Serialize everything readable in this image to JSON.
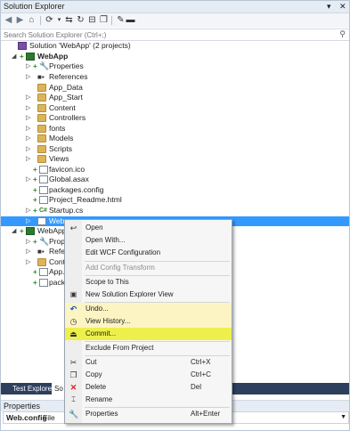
{
  "window": {
    "title": "Solution Explorer",
    "pin_glyph": "▾",
    "close_glyph": "✕"
  },
  "search": {
    "placeholder": "Search Solution Explorer (Ctrl+;)"
  },
  "tree": [
    {
      "label": "Solution 'WebApp' (2 projects)",
      "icon": "solution-icon"
    },
    {
      "label": "WebApp",
      "icon": "project-icon"
    },
    {
      "label": "Properties",
      "icon": "wrench-icon"
    },
    {
      "label": "References",
      "icon": "references-icon"
    },
    {
      "label": "App_Data",
      "icon": "folder-icon"
    },
    {
      "label": "App_Start",
      "icon": "folder-icon"
    },
    {
      "label": "Content",
      "icon": "folder-icon"
    },
    {
      "label": "Controllers",
      "icon": "folder-icon"
    },
    {
      "label": "fonts",
      "icon": "folder-icon"
    },
    {
      "label": "Models",
      "icon": "folder-icon"
    },
    {
      "label": "Scripts",
      "icon": "folder-icon"
    },
    {
      "label": "Views",
      "icon": "folder-icon"
    },
    {
      "label": "favicon.ico",
      "icon": "file-icon"
    },
    {
      "label": "Global.asax",
      "icon": "file-icon"
    },
    {
      "label": "packages.config",
      "icon": "file-icon"
    },
    {
      "label": "Project_Readme.html",
      "icon": "file-icon"
    },
    {
      "label": "Startup.cs",
      "icon": "csharp-file-icon"
    },
    {
      "label": "Web.c",
      "icon": "file-icon"
    },
    {
      "label": "WebApp",
      "icon": "project-icon"
    },
    {
      "label": "Prope",
      "icon": "wrench-icon"
    },
    {
      "label": "Refer",
      "icon": "references-icon"
    },
    {
      "label": "Conte",
      "icon": "folder-icon"
    },
    {
      "label": "App.c",
      "icon": "file-icon"
    },
    {
      "label": "packa",
      "icon": "file-icon"
    }
  ],
  "context_menu": [
    {
      "label": "Open",
      "shortcut": "",
      "icon": "open-icon"
    },
    {
      "label": "Open With...",
      "shortcut": "",
      "icon": ""
    },
    {
      "label": "Edit WCF Configuration",
      "shortcut": "",
      "icon": ""
    },
    {
      "label": "Add Config Transform",
      "shortcut": "",
      "icon": ""
    },
    {
      "label": "Scope to This",
      "shortcut": "",
      "icon": ""
    },
    {
      "label": "New Solution Explorer View",
      "shortcut": "",
      "icon": "new-view-icon"
    },
    {
      "label": "Undo...",
      "shortcut": "",
      "icon": "undo-icon"
    },
    {
      "label": "View History...",
      "shortcut": "",
      "icon": "history-icon"
    },
    {
      "label": "Commit...",
      "shortcut": "",
      "icon": "commit-icon"
    },
    {
      "label": "Exclude From Project",
      "shortcut": "",
      "icon": ""
    },
    {
      "label": "Cut",
      "shortcut": "Ctrl+X",
      "icon": "cut-icon"
    },
    {
      "label": "Copy",
      "shortcut": "Ctrl+C",
      "icon": "copy-icon"
    },
    {
      "label": "Delete",
      "shortcut": "Del",
      "icon": "delete-icon"
    },
    {
      "label": "Rename",
      "shortcut": "",
      "icon": "rename-icon"
    },
    {
      "label": "Properties",
      "shortcut": "Alt+Enter",
      "icon": "wrench-icon"
    }
  ],
  "bottom_tabs": {
    "tab1": "Test Explorer",
    "tab2": "So"
  },
  "properties": {
    "title": "Properties",
    "selected_name": "Web.config",
    "selected_type": "File"
  },
  "colors": {
    "selection": "#3399ff",
    "undo_highlight": "#fdf4c3",
    "commit_highlight": "#edf04c"
  }
}
